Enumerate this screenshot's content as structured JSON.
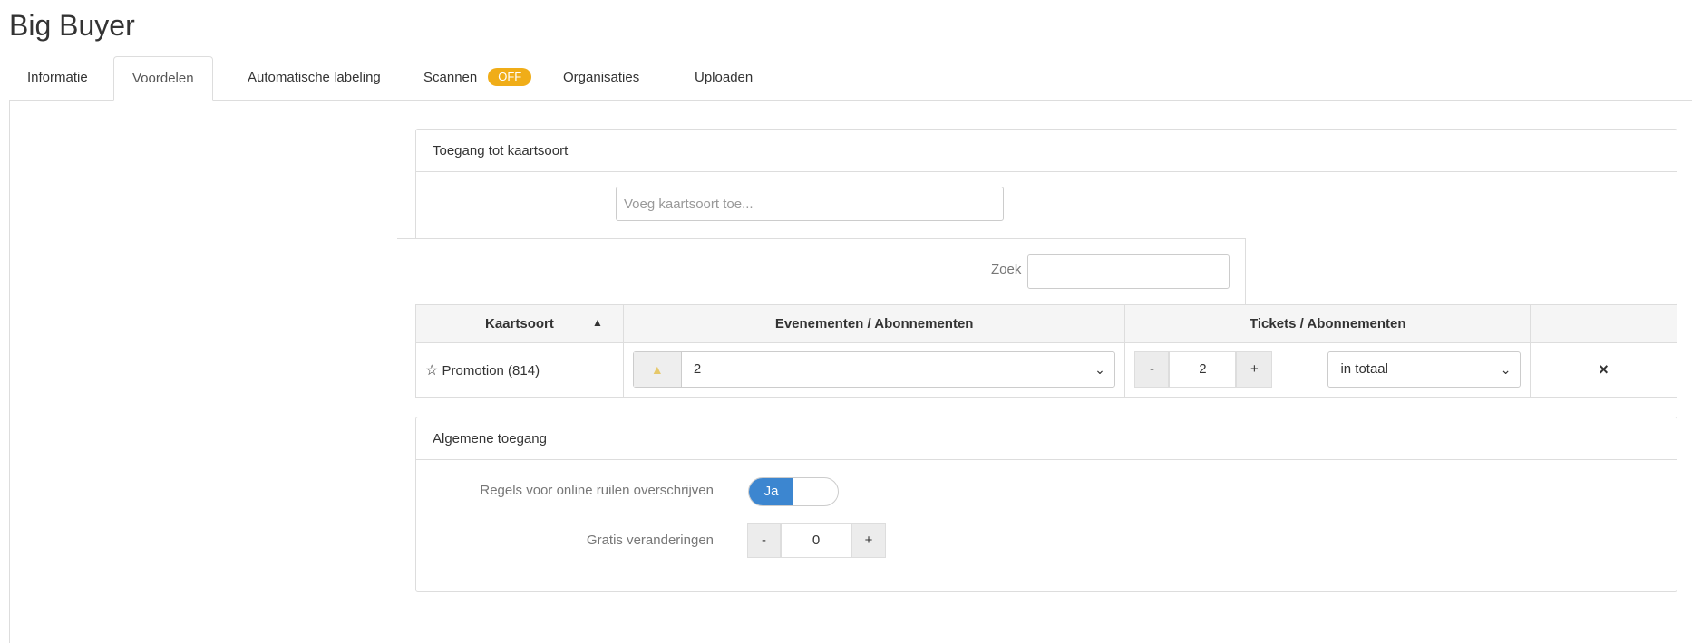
{
  "page": {
    "title": "Big Buyer"
  },
  "tabs": [
    {
      "label": "Informatie"
    },
    {
      "label": "Voordelen"
    },
    {
      "label": "Automatische labeling"
    },
    {
      "label": "Scannen",
      "badge": "OFF"
    },
    {
      "label": "Organisaties"
    },
    {
      "label": "Uploaden"
    }
  ],
  "ticket_access": {
    "heading": "Toegang tot kaartsoort",
    "add_placeholder": "Voeg kaartsoort toe...",
    "search_label": "Zoek",
    "search_value": "",
    "columns": [
      "Kaartsoort",
      "Evenementen / Abonnementen",
      "Tickets / Abonnementen",
      ""
    ],
    "rows": [
      {
        "name": "Promotion (814)",
        "events_value": "2",
        "tickets_minus": "-",
        "tickets_value": "2",
        "tickets_plus": "+",
        "scope": "in totaal",
        "remove": "×"
      }
    ]
  },
  "general_access": {
    "heading": "Algemene toegang",
    "override_label": "Regels voor online ruilen overschrijven",
    "override_toggle": "Ja",
    "free_changes_label": "Gratis veranderingen",
    "free_changes_minus": "-",
    "free_changes_value": "0",
    "free_changes_plus": "+"
  },
  "colors": {
    "accent": "#3c86d0",
    "badge": "#f0ad18",
    "warning": "#e6c86a"
  }
}
